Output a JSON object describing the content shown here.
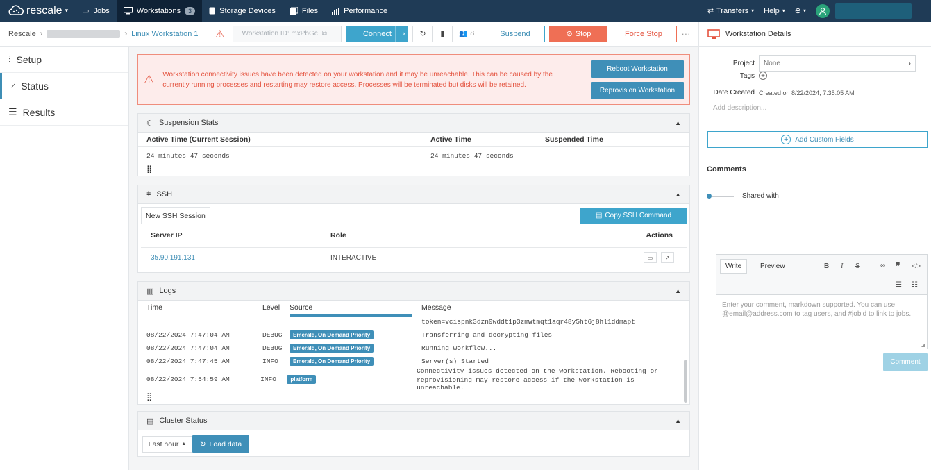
{
  "topnav": {
    "brand": "rescale",
    "items": [
      {
        "label": "Jobs",
        "icon": "jobs-icon"
      },
      {
        "label": "Workstations",
        "icon": "monitor-icon",
        "count": "3"
      },
      {
        "label": "Storage Devices",
        "icon": "storage-icon"
      },
      {
        "label": "Files",
        "icon": "files-icon"
      },
      {
        "label": "Performance",
        "icon": "bar-chart-icon"
      }
    ],
    "transfers": "Transfers",
    "help": "Help"
  },
  "breadcrumb": {
    "root": "Rescale",
    "current": "Linux Workstation 1"
  },
  "toolbar": {
    "workstation_id": "Workstation ID: mxPbGc",
    "connect": "Connect",
    "users_count": "8",
    "suspend": "Suspend",
    "stop": "Stop",
    "force_stop": "Force Stop",
    "more": "···"
  },
  "details_header": "Workstation Details",
  "sidebar": {
    "items": [
      {
        "label": "Setup"
      },
      {
        "label": "Status"
      },
      {
        "label": "Results"
      }
    ]
  },
  "alert": {
    "line1": "Workstation connectivity issues have been detected on your workstation and it may be unreachable. This can be caused by the",
    "line2": "currently running processes and restarting may restore access. Processes will be terminated but disks will be retained.",
    "reboot": "Reboot Workstation",
    "reprovision": "Reprovision Workstation"
  },
  "suspension": {
    "title": "Suspension Stats",
    "headers": [
      "Active Time (Current Session)",
      "Active Time",
      "Suspended Time"
    ],
    "values": [
      "24 minutes 47 seconds",
      "24 minutes 47 seconds",
      ""
    ]
  },
  "ssh": {
    "title": "SSH",
    "tab": "New SSH Session",
    "copy": "Copy SSH Command",
    "headers": [
      "Server IP",
      "Role",
      "Actions"
    ],
    "rows": [
      {
        "ip": "35.90.191.131",
        "role": "INTERACTIVE"
      }
    ]
  },
  "logs": {
    "title": "Logs",
    "headers": [
      "Time",
      "Level",
      "Source",
      "Message"
    ],
    "token_line": "token=vcispnk3dzn9wddt1p3zmwtmqt1aqr48y5ht6j8hl1ddmapt",
    "rows": [
      {
        "time": "08/22/2024 7:47:04 AM",
        "level": "DEBUG",
        "source": "Emerald, On Demand Priority",
        "message": "Transferring and decrypting files"
      },
      {
        "time": "08/22/2024 7:47:04 AM",
        "level": "DEBUG",
        "source": "Emerald, On Demand Priority",
        "message": "Running workflow..."
      },
      {
        "time": "08/22/2024 7:47:45 AM",
        "level": "INFO",
        "source": "Emerald, On Demand Priority",
        "message": "Server(s) Started"
      },
      {
        "time": "08/22/2024 7:54:59 AM",
        "level": "INFO",
        "source": "platform",
        "message": "Connectivity issues detected on the workstation. Rebooting or",
        "message2": "reprovisioning may restore access if the workstation is unreachable."
      }
    ]
  },
  "cluster": {
    "title": "Cluster Status",
    "range": "Last hour",
    "load": "Load data"
  },
  "details": {
    "project_label": "Project",
    "project_value": "None",
    "tags_label": "Tags",
    "date_label": "Date Created",
    "date_value": "Created on 8/22/2024, 7:35:05 AM",
    "description_placeholder": "Add description...",
    "add_custom_fields": "Add Custom Fields"
  },
  "comments": {
    "title": "Comments",
    "shared_with": "Shared with",
    "write": "Write",
    "preview": "Preview",
    "placeholder_line1": "Enter your comment, markdown supported. You can use",
    "placeholder_line2": "@email@address.com to tag users, and #jobid to link to jobs.",
    "submit": "Comment"
  }
}
